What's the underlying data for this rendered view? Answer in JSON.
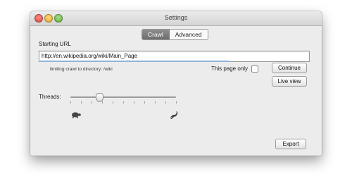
{
  "window": {
    "title": "Settings"
  },
  "tabs": [
    {
      "label": "Crawl",
      "active": true
    },
    {
      "label": "Advanced",
      "active": false
    }
  ],
  "crawl": {
    "starting_url_label": "Starting URL",
    "starting_url_value": "http://en.wikipedia.org/wiki/Main_Page",
    "directory_hint": "limiting crawl to directory: /wiki",
    "this_page_only_label": "This page only",
    "this_page_only_checked": false,
    "continue_label": "Continue",
    "live_view_label": "Live view",
    "threads_label": "Threads:",
    "threads_level_fraction": 0.27,
    "slow_icon": "turtle-icon",
    "fast_icon": "rabbit-icon",
    "export_label": "Export"
  },
  "colors": {
    "active_tab": "#7a7a7a",
    "window_background": "#ececec",
    "url_progress": "#8fb3d9"
  }
}
